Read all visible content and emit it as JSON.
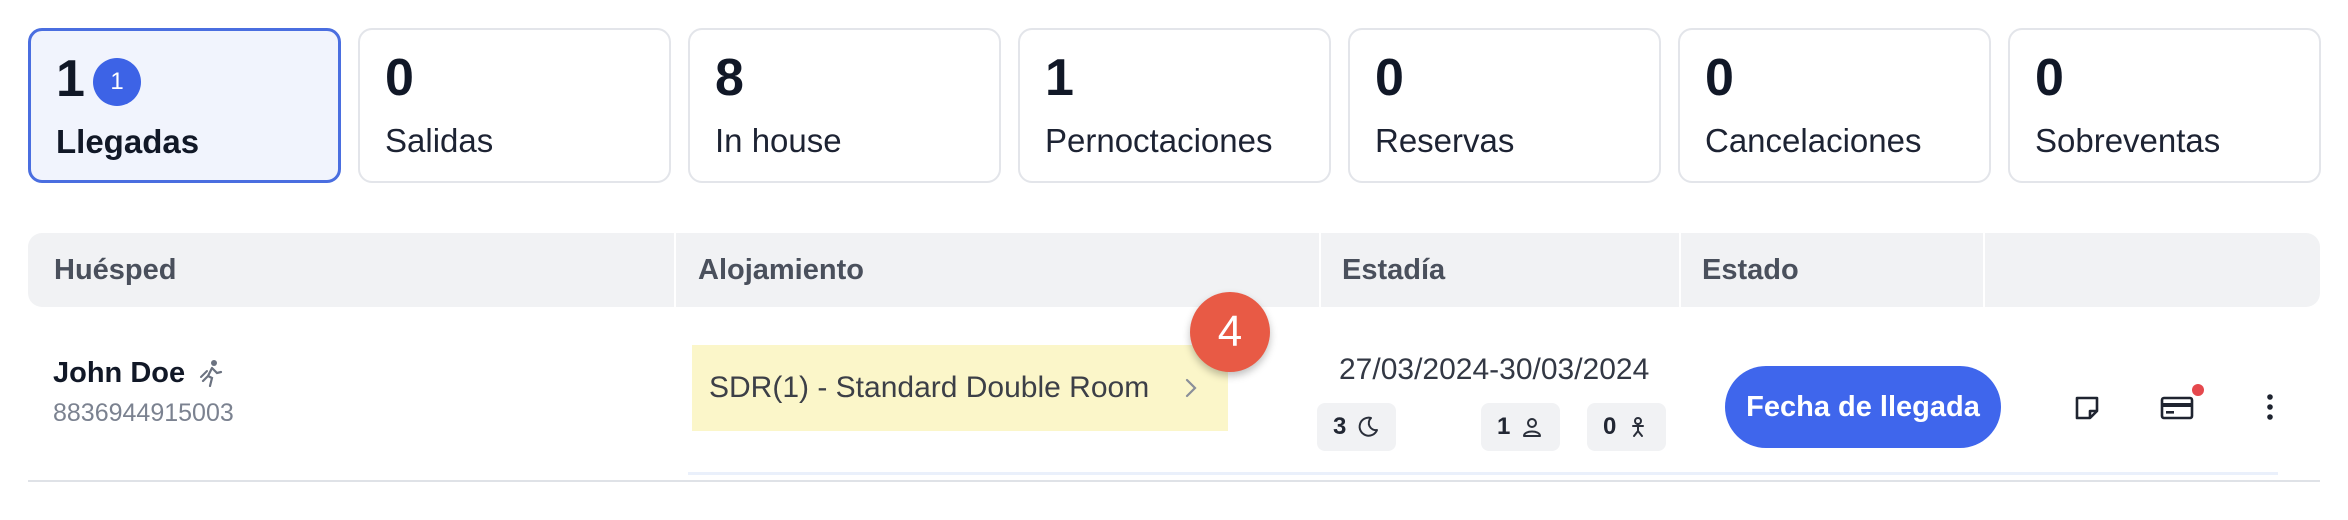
{
  "cards": [
    {
      "count": "1",
      "label": "Llegadas",
      "badge": "1",
      "active": true
    },
    {
      "count": "0",
      "label": "Salidas"
    },
    {
      "count": "8",
      "label": "In house"
    },
    {
      "count": "1",
      "label": "Pernoctaciones"
    },
    {
      "count": "0",
      "label": "Reservas"
    },
    {
      "count": "0",
      "label": "Cancelaciones"
    },
    {
      "count": "0",
      "label": "Sobreventas"
    }
  ],
  "table": {
    "headers": {
      "guest": "Huésped",
      "accommodation": "Alojamiento",
      "stay": "Estadía",
      "status": "Estado"
    },
    "rows": [
      {
        "guest_name": "John Doe",
        "guest_id": "8836944915003",
        "room": "SDR(1) - Standard Double Room",
        "step_marker": "4",
        "dates": "27/03/2024-30/03/2024",
        "nights": "3",
        "adults": "1",
        "children": "0",
        "status_button": "Fecha de llegada"
      }
    ]
  },
  "colors": {
    "accent": "#3f66ec",
    "active_card_border": "#4a6ee0",
    "room_highlight": "#fbf6c9",
    "step_marker": "#e85a45",
    "notification_dot": "#e5484d"
  },
  "icons": {
    "walk": "walking-person-icon",
    "chevron": "chevron-right-icon",
    "nights": "moon-icon",
    "adults": "person-icon",
    "children": "baby-icon",
    "note": "sticky-note-icon",
    "payment": "credit-card-icon",
    "more": "vertical-dots-icon"
  }
}
